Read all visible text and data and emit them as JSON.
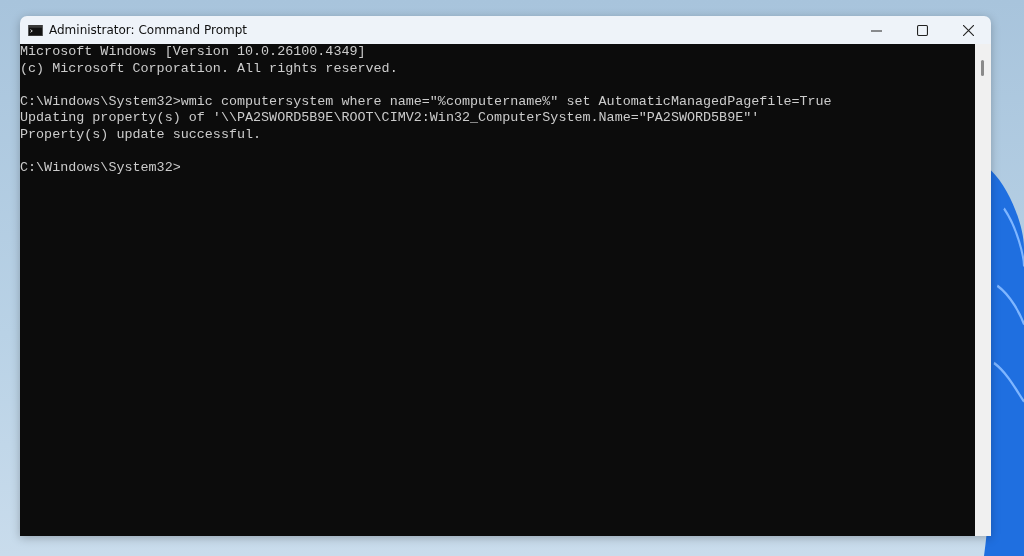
{
  "window": {
    "title": "Administrator: Command Prompt"
  },
  "console": {
    "blocks": [
      [
        "Microsoft Windows [Version 10.0.26100.4349]",
        "(c) Microsoft Corporation. All rights reserved."
      ],
      [
        "C:\\Windows\\System32>wmic computersystem where name=\"%computername%\" set AutomaticManagedPagefile=True",
        "Updating property(s) of '\\\\PA2SWORD5B9E\\ROOT\\CIMV2:Win32_ComputerSystem.Name=\"PA2SWORD5B9E\"'",
        "Property(s) update successful."
      ],
      [
        "C:\\Windows\\System32>"
      ]
    ]
  }
}
